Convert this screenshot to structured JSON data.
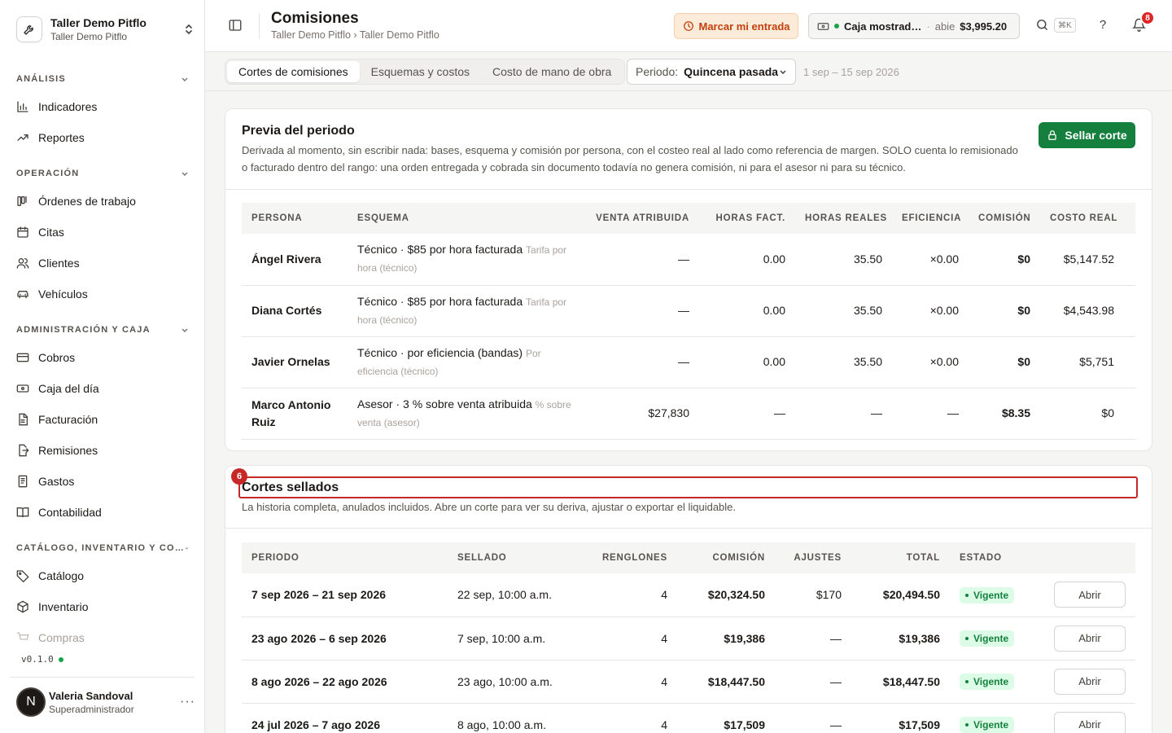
{
  "org": {
    "name": "Taller Demo Pitflo",
    "subtitle": "Taller Demo Pitflo"
  },
  "sidebar": {
    "sections": [
      {
        "label": "ANÁLISIS",
        "items": [
          {
            "label": "Indicadores",
            "icon": "bar-chart-icon"
          },
          {
            "label": "Reportes",
            "icon": "trending-icon"
          }
        ]
      },
      {
        "label": "OPERACIÓN",
        "items": [
          {
            "label": "Órdenes de trabajo",
            "icon": "clipboard-icon"
          },
          {
            "label": "Citas",
            "icon": "calendar-icon"
          },
          {
            "label": "Clientes",
            "icon": "users-icon"
          },
          {
            "label": "Vehículos",
            "icon": "car-icon"
          }
        ]
      },
      {
        "label": "ADMINISTRACIÓN Y CAJA",
        "items": [
          {
            "label": "Cobros",
            "icon": "credit-card-icon"
          },
          {
            "label": "Caja del día",
            "icon": "cash-icon"
          },
          {
            "label": "Facturación",
            "icon": "file-icon"
          },
          {
            "label": "Remisiones",
            "icon": "file-export-icon"
          },
          {
            "label": "Gastos",
            "icon": "receipt-icon"
          },
          {
            "label": "Contabilidad",
            "icon": "book-icon"
          }
        ]
      },
      {
        "label": "CATÁLOGO, INVENTARIO Y CO…",
        "items": [
          {
            "label": "Catálogo",
            "icon": "tag-icon"
          },
          {
            "label": "Inventario",
            "icon": "box-icon"
          },
          {
            "label": "Compras",
            "icon": "cart-icon"
          }
        ]
      }
    ],
    "version": "v0.1.0",
    "user": {
      "initial": "N",
      "name": "Valeria Sandoval",
      "role": "Superadministrador"
    }
  },
  "header": {
    "title": "Comisiones",
    "breadcrumb": "Taller Demo Pitflo › Taller Demo Pitflo",
    "entrada_label": "Marcar mi entrada",
    "caja": {
      "name": "Caja mostrad…",
      "state": "abie",
      "amount": "$3,995.20"
    },
    "search_shortcut": "⌘K",
    "help": "?",
    "notifications": "8"
  },
  "tabs": [
    "Cortes de comisiones",
    "Esquemas y costos",
    "Costo de mano de obra"
  ],
  "periodo": {
    "label": "Periodo:",
    "value": "Quincena pasada",
    "range": "1 sep – 15 sep 2026"
  },
  "preview": {
    "title": "Previa del periodo",
    "description": "Derivada al momento, sin escribir nada: bases, esquema y comisión por persona, con el costeo real al lado como referencia de margen. SOLO cuenta lo remisionado o facturado dentro del rango: una orden entregada y cobrada sin documento todavía no genera comisión, ni para el asesor ni para su técnico.",
    "seal_button": "Sellar corte",
    "columns": [
      "PERSONA",
      "ESQUEMA",
      "VENTA ATRIBUIDA",
      "HORAS FACT.",
      "HORAS REALES",
      "EFICIENCIA",
      "COMISIÓN",
      "COSTO REAL"
    ],
    "rows": [
      {
        "persona": "Ángel Rivera",
        "esquema": "Técnico · $85 por hora facturada",
        "esquema_sub": "Tarifa por hora (técnico)",
        "venta": "—",
        "horas_fact": "0.00",
        "horas_reales": "35.50",
        "eficiencia": "×0.00",
        "comision": "$0",
        "costo": "$5,147.52"
      },
      {
        "persona": "Diana Cortés",
        "esquema": "Técnico · $85 por hora facturada",
        "esquema_sub": "Tarifa por hora (técnico)",
        "venta": "—",
        "horas_fact": "0.00",
        "horas_reales": "35.50",
        "eficiencia": "×0.00",
        "comision": "$0",
        "costo": "$4,543.98"
      },
      {
        "persona": "Javier Ornelas",
        "esquema": "Técnico · por eficiencia (bandas)",
        "esquema_sub": "Por eficiencia (técnico)",
        "venta": "—",
        "horas_fact": "0.00",
        "horas_reales": "35.50",
        "eficiencia": "×0.00",
        "comision": "$0",
        "costo": "$5,751"
      },
      {
        "persona": "Marco Antonio Ruiz",
        "esquema": "Asesor · 3 % sobre venta atribuida",
        "esquema_sub": "% sobre venta (asesor)",
        "venta": "$27,830",
        "horas_fact": "—",
        "horas_reales": "—",
        "eficiencia": "—",
        "comision": "$8.35",
        "costo": "$0"
      }
    ]
  },
  "sealed": {
    "title": "Cortes sellados",
    "description": "La historia completa, anulados incluidos. Abre un corte para ver su deriva, ajustar o exportar el liquidable.",
    "highlight_badge": "6",
    "columns": [
      "PERIODO",
      "SELLADO",
      "RENGLONES",
      "COMISIÓN",
      "AJUSTES",
      "TOTAL",
      "ESTADO",
      ""
    ],
    "rows": [
      {
        "periodo": "7 sep 2026 – 21 sep 2026",
        "sellado": "22 sep, 10:00 a.m.",
        "renglones": "4",
        "comision": "$20,324.50",
        "ajustes": "$170",
        "total": "$20,494.50",
        "estado": "Vigente",
        "action": "Abrir"
      },
      {
        "periodo": "23 ago 2026 – 6 sep 2026",
        "sellado": "7 sep, 10:00 a.m.",
        "renglones": "4",
        "comision": "$19,386",
        "ajustes": "—",
        "total": "$19,386",
        "estado": "Vigente",
        "action": "Abrir"
      },
      {
        "periodo": "8 ago 2026 – 22 ago 2026",
        "sellado": "23 ago, 10:00 a.m.",
        "renglones": "4",
        "comision": "$18,447.50",
        "ajustes": "—",
        "total": "$18,447.50",
        "estado": "Vigente",
        "action": "Abrir"
      },
      {
        "periodo": "24 jul 2026 – 7 ago 2026",
        "sellado": "8 ago, 10:00 a.m.",
        "renglones": "4",
        "comision": "$17,509",
        "ajustes": "—",
        "total": "$17,509",
        "estado": "Vigente",
        "action": "Abrir"
      }
    ]
  },
  "colors": {
    "accent_green": "#15803d",
    "warning_orange": "#c2410c",
    "highlight_red": "#c62828"
  }
}
